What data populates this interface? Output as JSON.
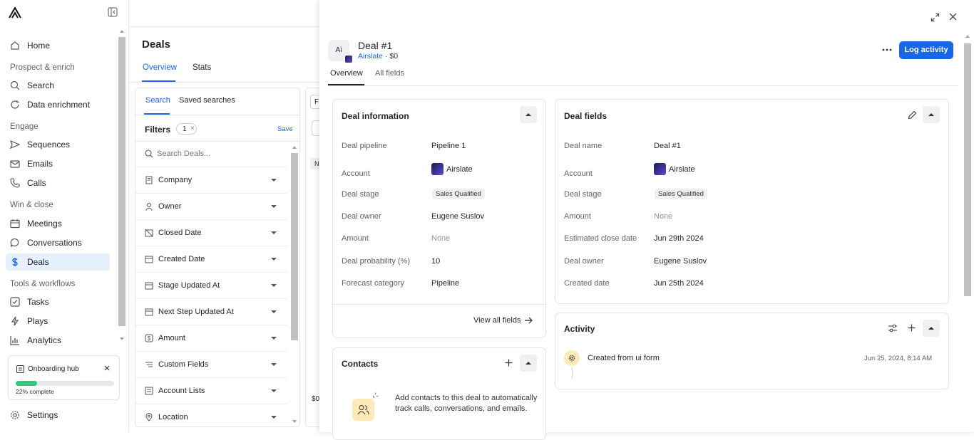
{
  "sidebar": {
    "items": [
      {
        "label": "Home",
        "icon": "home-icon"
      },
      {
        "label": "Search",
        "icon": "search-icon"
      },
      {
        "label": "Data enrichment",
        "icon": "refresh-icon"
      },
      {
        "label": "Sequences",
        "icon": "send-icon"
      },
      {
        "label": "Emails",
        "icon": "mail-icon"
      },
      {
        "label": "Calls",
        "icon": "phone-icon"
      },
      {
        "label": "Meetings",
        "icon": "calendar-icon"
      },
      {
        "label": "Conversations",
        "icon": "chat-icon"
      },
      {
        "label": "Deals",
        "icon": "dollar-icon"
      },
      {
        "label": "Tasks",
        "icon": "checkbox-icon"
      },
      {
        "label": "Plays",
        "icon": "lightning-icon"
      },
      {
        "label": "Analytics",
        "icon": "chart-icon"
      }
    ],
    "sections": [
      "Prospect & enrich",
      "Engage",
      "Win & close",
      "Tools & workflows"
    ],
    "settings_label": "Settings",
    "onboarding": {
      "title": "Onboarding hub",
      "progress_text": "22% complete",
      "progress": 0.22
    }
  },
  "deals": {
    "title": "Deals",
    "tabs": [
      "Overview",
      "Stats"
    ],
    "filter_tabs": [
      "Search",
      "Saved searches"
    ],
    "filters_label": "Filters",
    "filter_count": "1",
    "save_label": "Save",
    "search_placeholder": "Search Deals...",
    "filters": [
      "Company",
      "Owner",
      "Closed Date",
      "Created Date",
      "Stage Updated At",
      "Next Step Updated At",
      "Amount",
      "Custom Fields",
      "Account Lists",
      "Location"
    ],
    "peek": {
      "a": "F",
      "b": "N",
      "c": "$0"
    }
  },
  "panel": {
    "avatar": "Ai",
    "title": "Deal #1",
    "account_link": "Airslate",
    "amount_sub": "· $0",
    "log_activity": "Log activity",
    "tabs": [
      "Overview",
      "All fields"
    ],
    "deal_info": {
      "title": "Deal information",
      "pipeline_label": "Deal pipeline",
      "pipeline": "Pipeline 1",
      "account_label": "Account",
      "account": "Airslate",
      "stage_label": "Deal stage",
      "stage": "Sales Qualified",
      "owner_label": "Deal owner",
      "owner": "Eugene Suslov",
      "amount_label": "Amount",
      "amount": "None",
      "prob_label": "Deal probability (%)",
      "prob": "10",
      "forecast_label": "Forecast category",
      "forecast": "Pipeline",
      "view_all": "View all fields"
    },
    "deal_fields": {
      "title": "Deal fields",
      "name_label": "Deal name",
      "name": "Deal #1",
      "account_label": "Account",
      "account": "Airslate",
      "stage_label": "Deal stage",
      "stage": "Sales Qualified",
      "amount_label": "Amount",
      "amount": "None",
      "close_label": "Estimated close date",
      "close": "Jun 29th 2024",
      "owner_label": "Deal owner",
      "owner": "Eugene Suslov",
      "created_label": "Created date",
      "created": "Jun 25th 2024"
    },
    "contacts": {
      "title": "Contacts",
      "empty_text": "Add contacts to this deal to automatically track calls, conversations, and emails."
    },
    "activity": {
      "title": "Activity",
      "entry": "Created from ui form",
      "time": "Jun 25, 2024, 8:14 AM"
    }
  }
}
